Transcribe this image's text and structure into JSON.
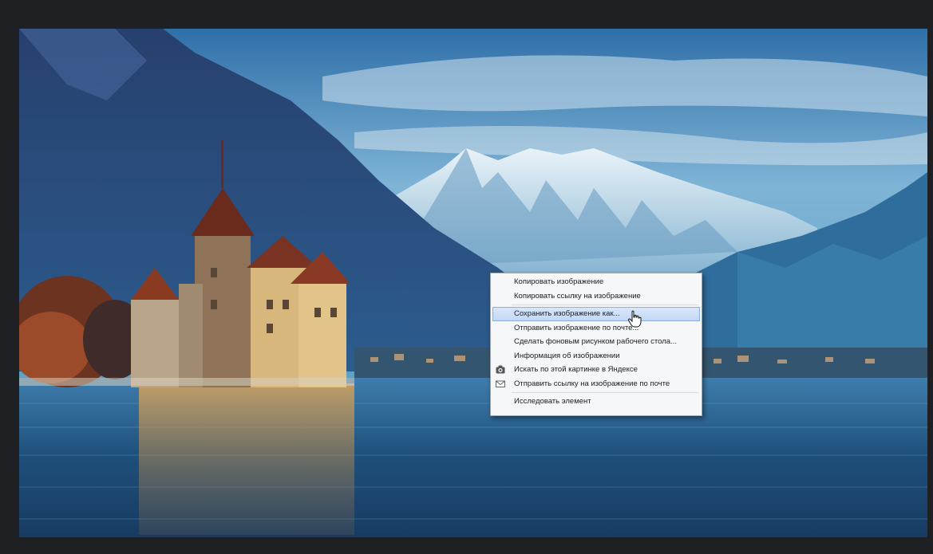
{
  "context_menu": {
    "items": [
      {
        "label": "Копировать изображение",
        "icon": null
      },
      {
        "label": "Копировать ссылку на изображение",
        "icon": null
      },
      {
        "label": "Сохранить изображение как...",
        "icon": null,
        "highlighted": true
      },
      {
        "label": "Отправить изображение по почте...",
        "icon": null
      },
      {
        "label": "Сделать фоновым рисунком рабочего стола...",
        "icon": null
      },
      {
        "label": "Информация об изображении",
        "icon": null
      },
      {
        "label": "Искать по этой картинке в Яндексе",
        "icon": "camera-icon"
      },
      {
        "label": "Отправить ссылку на изображение по почте",
        "icon": "envelope-icon"
      },
      {
        "label": "Исследовать элемент",
        "icon": null
      }
    ]
  },
  "colors": {
    "viewer_background": "#1f2023",
    "menu_background": "#f6f7f9",
    "menu_highlight": "#c3d7f5",
    "sky_top": "#2f6fa8",
    "lake": "#1e4f7a"
  },
  "cursor_icon": "hand-pointer-icon"
}
